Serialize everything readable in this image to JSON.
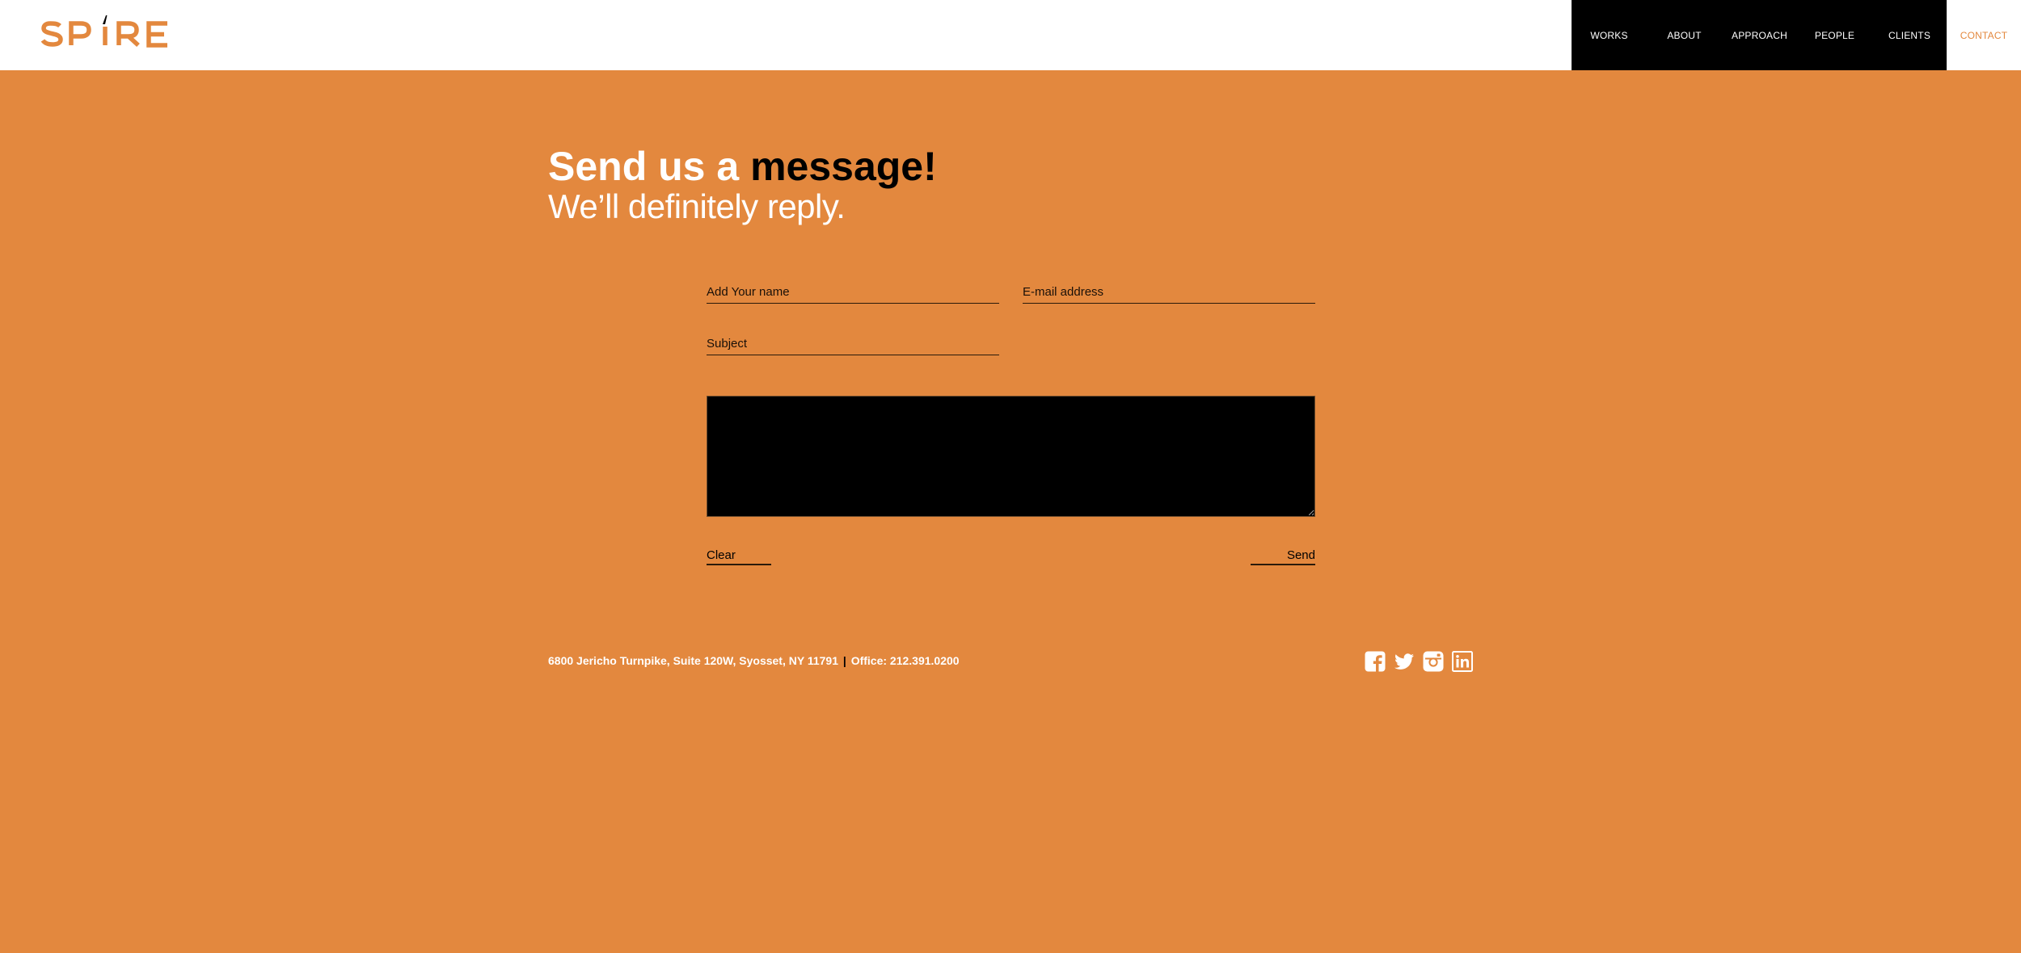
{
  "brand": {
    "name": "SPIRE",
    "color": "#e3883e"
  },
  "nav": {
    "items": [
      {
        "label": "WORKS"
      },
      {
        "label": "ABOUT"
      },
      {
        "label": "APPROACH"
      },
      {
        "label": "PEOPLE"
      },
      {
        "label": "CLIENTS"
      },
      {
        "label": "CONTACT",
        "active": true
      }
    ]
  },
  "hero": {
    "title_part1": "Send us a ",
    "title_part2": "message!",
    "subtitle": "We’ll definitely reply."
  },
  "form": {
    "name_placeholder": "Add Your name",
    "email_placeholder": "E-mail address",
    "subject_placeholder": "Subject",
    "message_value": "",
    "clear_label": "Clear",
    "send_label": "Send"
  },
  "footer": {
    "address": "6800 Jericho Turnpike, Suite 120W, Syosset, NY 11791",
    "separator": "|",
    "office": "Office: 212.391.0200",
    "social_icons": [
      "facebook-icon",
      "twitter-icon",
      "instagram-icon",
      "linkedin-icon"
    ]
  },
  "colors": {
    "background": "#e3883e",
    "nav_background": "#000000",
    "text_light": "#ffffff",
    "text_dark": "#000000"
  }
}
